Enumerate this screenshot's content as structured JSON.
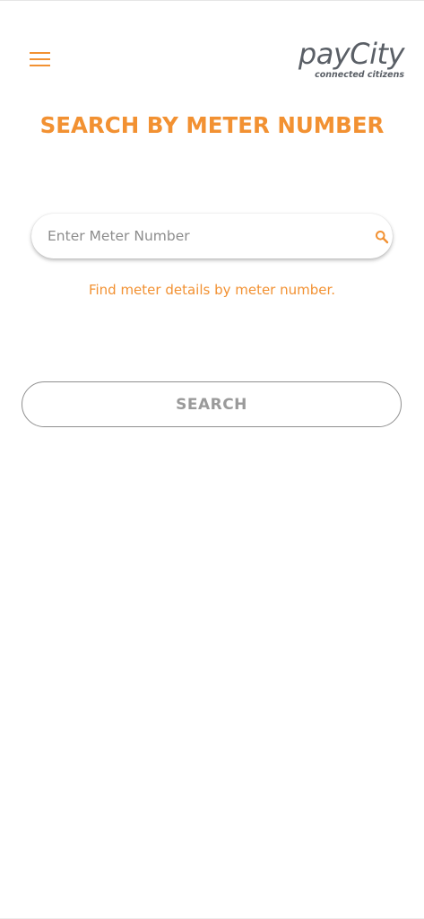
{
  "header": {
    "menu_icon": "hamburger-menu-icon",
    "logo": {
      "wordmark": "payCity",
      "tagline": "connected citizens"
    }
  },
  "main": {
    "title": "SEARCH BY METER NUMBER",
    "search": {
      "placeholder": "Enter Meter Number",
      "value": "",
      "icon": "search-icon"
    },
    "helper_text": "Find meter details by meter number.",
    "search_button_label": "SEARCH"
  },
  "colors": {
    "accent": "#f29132",
    "logo": "#5a5f66",
    "button_text": "#9a9a9a",
    "button_border": "#8f8f8f"
  }
}
